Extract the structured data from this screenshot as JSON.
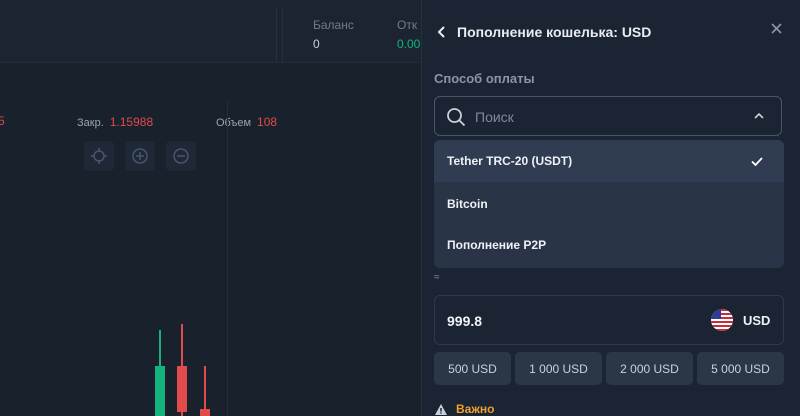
{
  "header_stats": {
    "balance_label": "Баланс",
    "balance_value": "0",
    "open_label": "Отк",
    "open_value": "0.00"
  },
  "ohlc": {
    "first_value": "5",
    "close_label": "Закр.",
    "close_value": "1.15988",
    "volume_label": "Объем",
    "volume_value": "108"
  },
  "chart_tools": [
    "crosshair-icon",
    "zoom-in-icon",
    "zoom-out-icon"
  ],
  "drawer": {
    "title": "Пополнение кошелька: USD",
    "payment_method_label": "Способ оплаты",
    "search_placeholder": "Поиск",
    "options": [
      {
        "label": "Tether TRC-20 (USDT)",
        "selected": true
      },
      {
        "label": "Bitcoin",
        "selected": false
      },
      {
        "label": "Пополнение P2P",
        "selected": false
      }
    ],
    "approx_sign": "≈",
    "amount": "999.8",
    "currency": "USD",
    "presets": [
      "500 USD",
      "1 000 USD",
      "2 000 USD",
      "5 000 USD"
    ],
    "important_label": "Важно"
  },
  "colors": {
    "accent_up": "#14b37d",
    "accent_down": "#e24b4b",
    "warning": "#f0a02e",
    "panel": "#1b2432",
    "dropdown": "#293547"
  }
}
